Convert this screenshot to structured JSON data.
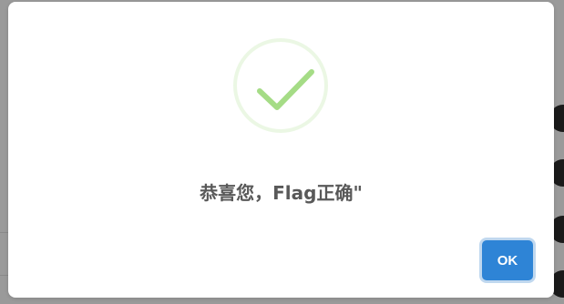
{
  "dialog": {
    "icon": "success-check-icon",
    "title": "恭喜您，Flag正确\"",
    "ok_label": "OK"
  },
  "colors": {
    "check": "#a5dc86",
    "button": "#2e84d6",
    "title_text": "#595959",
    "overlay": "#9a9a9a"
  }
}
